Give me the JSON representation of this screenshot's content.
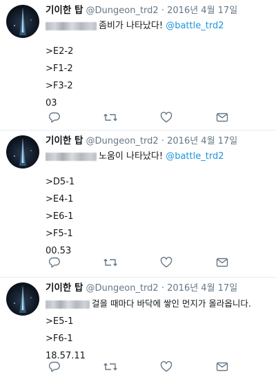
{
  "tweets": [
    {
      "name": "기이한 탑",
      "handle": "@Dungeon_trd2",
      "separator": "·",
      "date": "2016년 4월 17일",
      "first_line": "좀비가 나타났다!",
      "mention": "@battle_trd2",
      "lines": [
        ">E2-2",
        ">F1-2",
        ">F3-2",
        "03"
      ]
    },
    {
      "name": "기이한 탑",
      "handle": "@Dungeon_trd2",
      "separator": "·",
      "date": "2016년 4월 17일",
      "first_line": "노움이 나타났다!",
      "mention": "@battle_trd2",
      "lines": [
        ">D5-1",
        ">E4-1",
        ">E6-1",
        ">F5-1",
        "00.53"
      ]
    },
    {
      "name": "기이한 탑",
      "handle": "@Dungeon_trd2",
      "separator": "·",
      "date": "2016년 4월 17일",
      "first_line": "걸을 때마다 바닥에 쌓인 먼지가 올라옵니다.",
      "mention": "",
      "lines": [
        ">E5-1",
        ">F6-1",
        "18.57.11"
      ]
    }
  ],
  "icons": {
    "reply": "reply-icon",
    "retweet": "retweet-icon",
    "like": "heart-icon",
    "message": "envelope-icon"
  },
  "colors": {
    "link": "#1b95e0",
    "text": "#14171a",
    "muted": "#657786",
    "divider": "#e6ecf0"
  }
}
